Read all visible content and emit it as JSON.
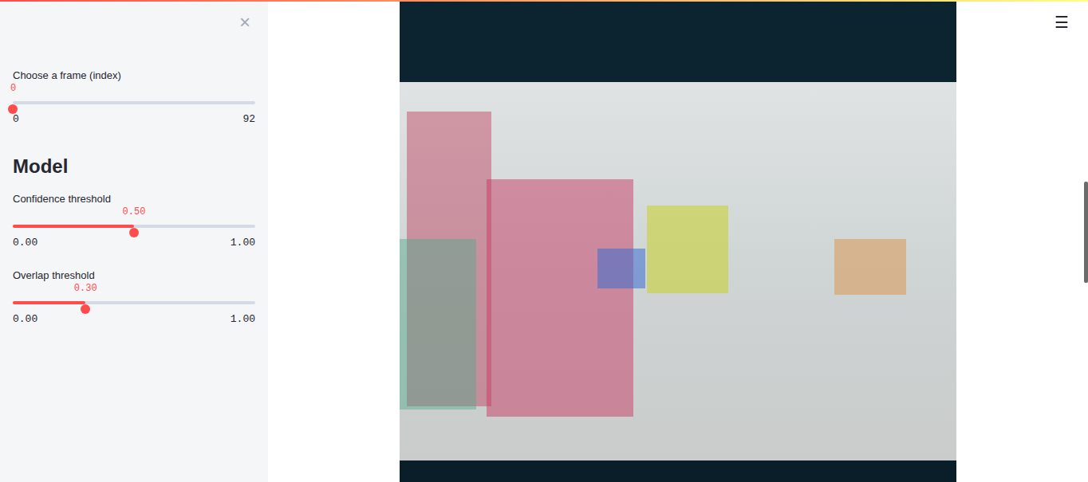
{
  "sidebar": {
    "close": "×",
    "sections": [
      {
        "heading": null,
        "sliders": [
          {
            "label": "Choose a frame (index)",
            "value": "0",
            "min": "0",
            "max": "92",
            "level": 0
          }
        ]
      },
      {
        "heading": "Model",
        "sliders": [
          {
            "label": "Confidence threshold",
            "value": "0.50",
            "min": "0.00",
            "max": "1.00",
            "level": 0.5
          },
          {
            "label": "Overlap threshold",
            "value": "0.30",
            "min": "0.00",
            "max": "1.00",
            "level": 0.3
          }
        ]
      }
    ]
  },
  "menu": "☰"
}
